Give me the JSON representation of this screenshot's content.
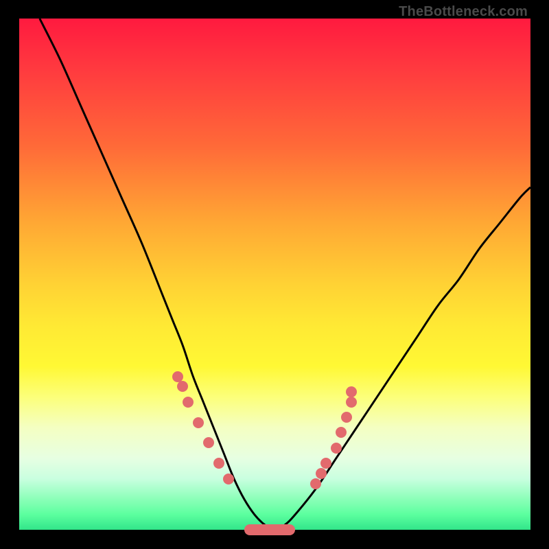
{
  "attribution": "TheBottleneck.com",
  "chart_data": {
    "type": "line",
    "title": "",
    "xlabel": "",
    "ylabel": "",
    "xlim": [
      0,
      100
    ],
    "ylim": [
      0,
      100
    ],
    "grid": false,
    "legend": false,
    "series": [
      {
        "name": "bottleneck-curve",
        "x": [
          4,
          8,
          12,
          16,
          20,
          24,
          28,
          30,
          32,
          34,
          36,
          38,
          40,
          42,
          44,
          46,
          48,
          50,
          52,
          54,
          58,
          62,
          66,
          70,
          74,
          78,
          82,
          86,
          90,
          94,
          98,
          100
        ],
        "y": [
          100,
          92,
          83,
          74,
          65,
          56,
          46,
          41,
          36,
          30,
          25,
          20,
          15,
          10,
          6,
          3,
          1,
          0,
          1,
          3,
          8,
          14,
          20,
          26,
          32,
          38,
          44,
          49,
          55,
          60,
          65,
          67
        ]
      }
    ],
    "markers": {
      "left_cluster": [
        [
          31,
          30
        ],
        [
          32,
          28
        ],
        [
          33,
          25
        ],
        [
          35,
          21
        ],
        [
          37,
          17
        ],
        [
          39,
          13
        ],
        [
          41,
          10
        ]
      ],
      "right_cluster": [
        [
          58,
          9
        ],
        [
          59,
          11
        ],
        [
          60,
          13
        ],
        [
          62,
          16
        ],
        [
          63,
          19
        ],
        [
          64,
          22
        ],
        [
          65,
          25
        ],
        [
          65,
          27
        ]
      ],
      "flat_band": {
        "x_start": 44,
        "x_end": 54,
        "y": 0
      }
    },
    "annotations": []
  },
  "colors": {
    "marker": "#e26a6d",
    "curve": "#000000"
  }
}
